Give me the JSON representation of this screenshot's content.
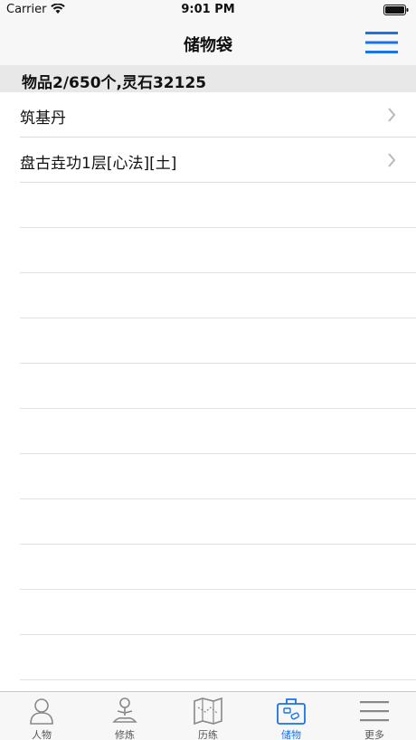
{
  "status_bar": {
    "carrier": "Carrier",
    "time": "9:01 PM"
  },
  "nav": {
    "title": "储物袋",
    "menu_icon": "hamburger-menu-icon"
  },
  "summary": {
    "text": "物品2/650个,灵石32125"
  },
  "items": [
    {
      "label": "筑基丹"
    },
    {
      "label": "盘古垚功1层[心法][土]"
    }
  ],
  "tabs": [
    {
      "label": "人物",
      "icon": "person-icon",
      "active": false
    },
    {
      "label": "修炼",
      "icon": "meditation-icon",
      "active": false
    },
    {
      "label": "历练",
      "icon": "map-icon",
      "active": false
    },
    {
      "label": "储物",
      "icon": "bag-icon",
      "active": true
    },
    {
      "label": "更多",
      "icon": "more-icon",
      "active": false
    }
  ],
  "colors": {
    "accent": "#1a73e8",
    "nav_bg": "#f7f7f7",
    "summary_bg": "#e8e8e8"
  }
}
